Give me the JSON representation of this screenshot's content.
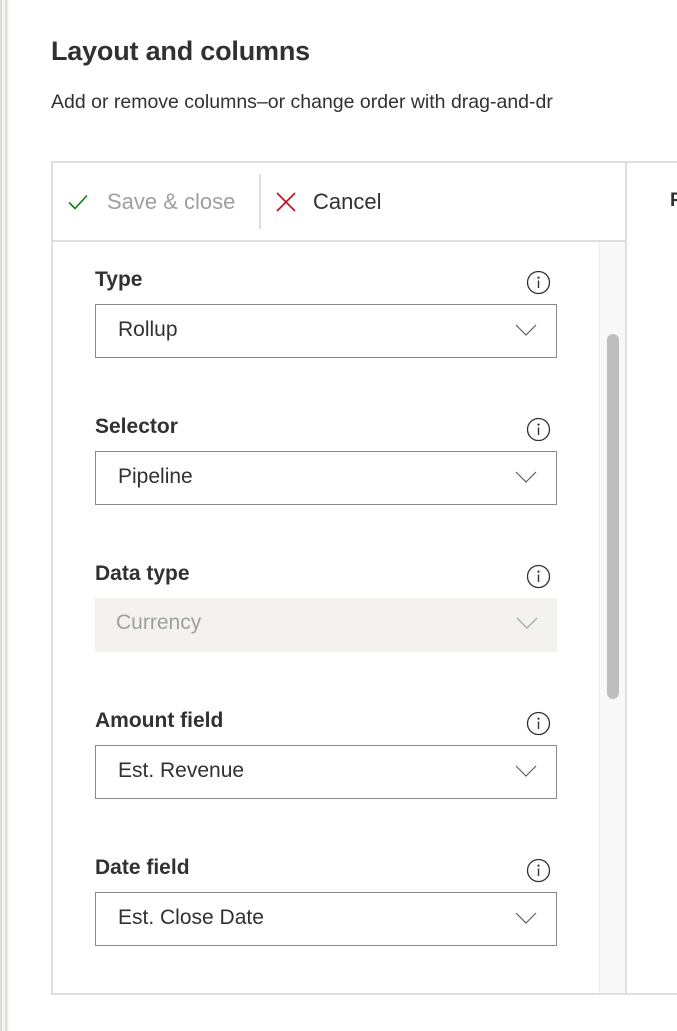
{
  "header": {
    "title": "Layout and columns",
    "subtitle": "Add or remove columns–or change order with drag-and-dr"
  },
  "toolbar": {
    "save_label": "Save & close",
    "save_icon": "checkmark-icon",
    "save_enabled": false,
    "cancel_label": "Cancel",
    "cancel_icon": "close-x-icon"
  },
  "right_pane": {
    "heading_partial": "P"
  },
  "fields": [
    {
      "label": "Type",
      "value": "Rollup",
      "disabled": false,
      "info_icon": "info-icon"
    },
    {
      "label": "Selector",
      "value": "Pipeline",
      "disabled": false,
      "info_icon": "info-icon"
    },
    {
      "label": "Data type",
      "value": "Currency",
      "disabled": true,
      "info_icon": "info-icon"
    },
    {
      "label": "Amount field",
      "value": "Est. Revenue",
      "disabled": false,
      "info_icon": "info-icon"
    },
    {
      "label": "Date field",
      "value": "Est. Close Date",
      "disabled": false,
      "info_icon": "info-icon"
    }
  ],
  "colors": {
    "check_green": "#107c10",
    "cancel_red": "#c50f1f",
    "disabled_text": "#a19f9d",
    "text": "#323130",
    "border": "#e1dfdd"
  }
}
